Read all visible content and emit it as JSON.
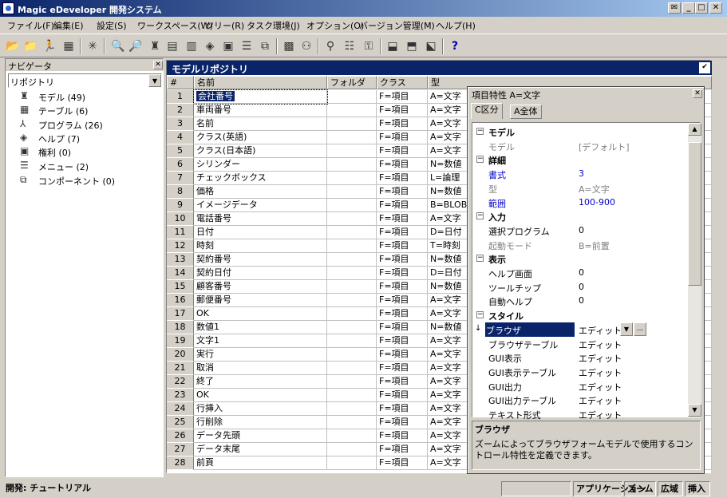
{
  "window": {
    "title": "Magic eDeveloper 開発システム"
  },
  "menu": [
    "ファイル(F)",
    "編集(E)",
    "設定(S)",
    "ワークスペース(W)",
    "ツリー(R)",
    "タスク環境(J)",
    "オプション(O)",
    "バージョン管理(M)",
    "ヘルプ(H)"
  ],
  "navigator": {
    "title": "ナビゲータ",
    "selected": "リポジトリ",
    "items": [
      {
        "icon": "model-icon",
        "label": "モデル",
        "count": "(49)"
      },
      {
        "icon": "table-icon",
        "label": "テーブル",
        "count": "(6)"
      },
      {
        "icon": "program-icon",
        "label": "プログラム",
        "count": "(26)"
      },
      {
        "icon": "help-icon",
        "label": "ヘルプ",
        "count": "(7)"
      },
      {
        "icon": "rights-icon",
        "label": "権利",
        "count": "(0)"
      },
      {
        "icon": "menu-icon",
        "label": "メニュー",
        "count": "(2)"
      },
      {
        "icon": "component-icon",
        "label": "コンポーネント",
        "count": "(0)"
      }
    ]
  },
  "repository": {
    "title": "モデルリポジトリ",
    "columns": [
      "#",
      "名前",
      "フォルダ",
      "クラス",
      "型"
    ],
    "rows": [
      [
        "1",
        "会社番号",
        "",
        "F=項目",
        "A=文字"
      ],
      [
        "2",
        "車両番号",
        "",
        "F=項目",
        "A=文字"
      ],
      [
        "3",
        "名前",
        "",
        "F=項目",
        "A=文字"
      ],
      [
        "4",
        "クラス(英語)",
        "",
        "F=項目",
        "A=文字"
      ],
      [
        "5",
        "クラス(日本語)",
        "",
        "F=項目",
        "A=文字"
      ],
      [
        "6",
        "シリンダー",
        "",
        "F=項目",
        "N=数値"
      ],
      [
        "7",
        "チェックボックス",
        "",
        "F=項目",
        "L=論理"
      ],
      [
        "8",
        "価格",
        "",
        "F=項目",
        "N=数値"
      ],
      [
        "9",
        "イメージデータ",
        "",
        "F=項目",
        "B=BLOB"
      ],
      [
        "10",
        "電話番号",
        "",
        "F=項目",
        "A=文字"
      ],
      [
        "11",
        "日付",
        "",
        "F=項目",
        "D=日付"
      ],
      [
        "12",
        "時刻",
        "",
        "F=項目",
        "T=時刻"
      ],
      [
        "13",
        "契約番号",
        "",
        "F=項目",
        "N=数値"
      ],
      [
        "14",
        "契約日付",
        "",
        "F=項目",
        "D=日付"
      ],
      [
        "15",
        "顧客番号",
        "",
        "F=項目",
        "N=数値"
      ],
      [
        "16",
        "郵便番号",
        "",
        "F=項目",
        "A=文字"
      ],
      [
        "17",
        "OK",
        "",
        "F=項目",
        "A=文字"
      ],
      [
        "18",
        "数値1",
        "",
        "F=項目",
        "N=数値"
      ],
      [
        "19",
        "文字1",
        "",
        "F=項目",
        "A=文字"
      ],
      [
        "20",
        "実行",
        "",
        "F=項目",
        "A=文字"
      ],
      [
        "21",
        "取消",
        "",
        "F=項目",
        "A=文字"
      ],
      [
        "22",
        "終了",
        "",
        "F=項目",
        "A=文字"
      ],
      [
        "23",
        "OK",
        "",
        "F=項目",
        "A=文字"
      ],
      [
        "24",
        "行挿入",
        "",
        "F=項目",
        "A=文字"
      ],
      [
        "25",
        "行削除",
        "",
        "F=項目",
        "A=文字"
      ],
      [
        "26",
        "データ先頭",
        "",
        "F=項目",
        "A=文字"
      ],
      [
        "27",
        "データ末尾",
        "",
        "F=項目",
        "A=文字"
      ],
      [
        "28",
        "前頁",
        "",
        "F=項目",
        "A=文字"
      ]
    ]
  },
  "properties": {
    "title": "項目特性 A=文字",
    "tabs": [
      "C区分",
      "A全体"
    ],
    "rows": [
      {
        "type": "cat",
        "key": "モデル"
      },
      {
        "type": "prop",
        "key": "モデル",
        "value": "[デフォルト]",
        "style": "dim"
      },
      {
        "type": "cat",
        "key": "詳細"
      },
      {
        "type": "prop",
        "key": "書式",
        "value": "3",
        "style": "blue"
      },
      {
        "type": "prop",
        "key": "型",
        "value": "A=文字",
        "style": "dim"
      },
      {
        "type": "prop",
        "key": "範囲",
        "value": "100-900",
        "style": "blue"
      },
      {
        "type": "cat",
        "key": "入力"
      },
      {
        "type": "prop",
        "key": "選択プログラム",
        "value": "0",
        "style": ""
      },
      {
        "type": "prop",
        "key": "起動モード",
        "value": "B=前置",
        "style": "dim"
      },
      {
        "type": "cat",
        "key": "表示"
      },
      {
        "type": "prop",
        "key": "ヘルプ画面",
        "value": "0",
        "style": ""
      },
      {
        "type": "prop",
        "key": "ツールチップ",
        "value": "0",
        "style": ""
      },
      {
        "type": "prop",
        "key": "自動ヘルプ",
        "value": "0",
        "style": ""
      },
      {
        "type": "cat",
        "key": "スタイル"
      },
      {
        "type": "selected",
        "key": "ブラウザ",
        "value": "エディット"
      },
      {
        "type": "prop",
        "key": "ブラウザテーブル",
        "value": "エディット",
        "style": ""
      },
      {
        "type": "prop",
        "key": "GUI表示",
        "value": "エディット",
        "style": ""
      },
      {
        "type": "prop",
        "key": "GUI表示テーブル",
        "value": "エディット",
        "style": ""
      },
      {
        "type": "prop",
        "key": "GUI出力",
        "value": "エディット",
        "style": ""
      },
      {
        "type": "prop",
        "key": "GUI出力テーブル",
        "value": "エディット",
        "style": ""
      },
      {
        "type": "prop",
        "key": "テキスト形式",
        "value": "エディット",
        "style": ""
      }
    ],
    "description_title": "ブラウザ",
    "description": "ズームによってブラウザフォームモデルで使用するコントロール特性を定義できます。"
  },
  "status": {
    "left": "開発: チュートリアル",
    "panels": [
      "アプリケーション",
      "ズーム",
      "広域",
      "挿入"
    ]
  }
}
